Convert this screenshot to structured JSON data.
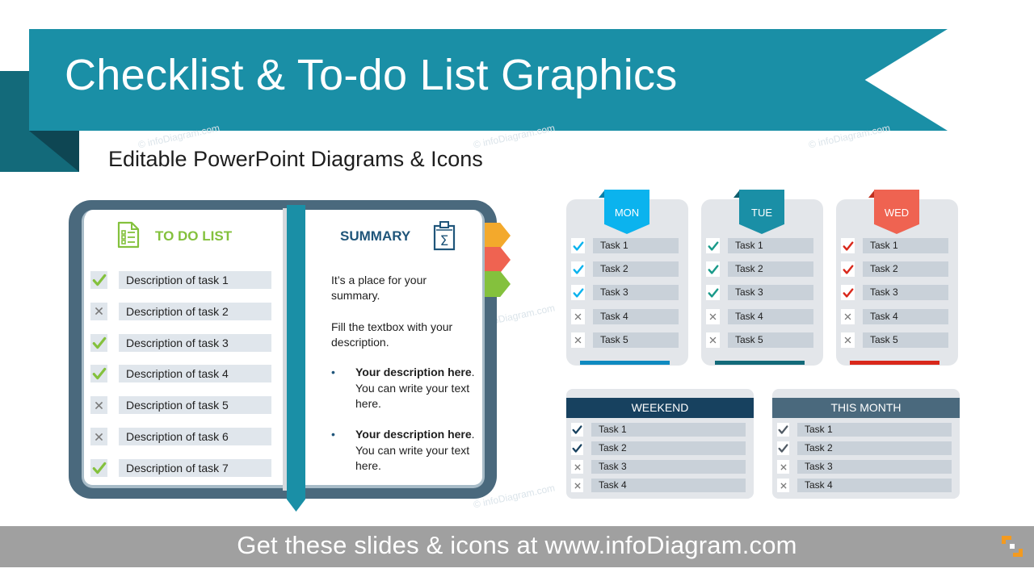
{
  "header": {
    "title": "Checklist & To-do List Graphics",
    "subtitle": "Editable PowerPoint Diagrams & Icons"
  },
  "watermark": "© infoDiagram.com",
  "colors": {
    "ribbon": "#1a8fa6",
    "todo_green": "#84c13d",
    "summary_blue": "#1f557a",
    "book_frame": "#4a697d",
    "mon": "#0bb3ee",
    "tue": "#1a8fa6",
    "wed": "#ef6351",
    "weekend": "#17415f",
    "this_month": "#4a697d",
    "footer": "#a0a0a0"
  },
  "book": {
    "todo": {
      "title": "TO DO LIST",
      "icon": "checklist-document-icon",
      "items": [
        {
          "label": "Description of task 1",
          "status": "done"
        },
        {
          "label": "Description of task 2",
          "status": "not-done"
        },
        {
          "label": "Description of task 3",
          "status": "done"
        },
        {
          "label": "Description of task 4",
          "status": "done"
        },
        {
          "label": "Description of task 5",
          "status": "not-done"
        },
        {
          "label": "Description of task 6",
          "status": "not-done"
        },
        {
          "label": "Description of task 7",
          "status": "done"
        }
      ]
    },
    "summary": {
      "title": "SUMMARY",
      "icon": "clipboard-sigma-icon",
      "para1": "It’s a place for your summary.",
      "para2": "Fill the textbox with your description.",
      "bullets": [
        {
          "bold": "Your description here",
          "rest": ". You can write your text here."
        },
        {
          "bold": "Your description here",
          "rest": ". You can write your text here."
        }
      ]
    },
    "tabs": [
      "#f3a92c",
      "#ef6351",
      "#84c13d"
    ]
  },
  "days": [
    {
      "label": "MON",
      "color": "#0bb3ee",
      "fold": "#0a7fa8",
      "bar": "#0f8ac0",
      "check_color": "#0bb3ee",
      "tasks": [
        {
          "label": "Task 1",
          "status": "done"
        },
        {
          "label": "Task 2",
          "status": "done"
        },
        {
          "label": "Task 3",
          "status": "done"
        },
        {
          "label": "Task 4",
          "status": "not-done"
        },
        {
          "label": "Task 5",
          "status": "not-done"
        }
      ]
    },
    {
      "label": "TUE",
      "color": "#1a8fa6",
      "fold": "#0e5e6e",
      "bar": "#136a7a",
      "check_color": "#1a9a8a",
      "tasks": [
        {
          "label": "Task 1",
          "status": "done"
        },
        {
          "label": "Task 2",
          "status": "done"
        },
        {
          "label": "Task 3",
          "status": "done"
        },
        {
          "label": "Task 4",
          "status": "not-done"
        },
        {
          "label": "Task 5",
          "status": "not-done"
        }
      ]
    },
    {
      "label": "WED",
      "color": "#ef6351",
      "fold": "#c0301f",
      "bar": "#d9281b",
      "check_color": "#d9281b",
      "tasks": [
        {
          "label": "Task 1",
          "status": "done"
        },
        {
          "label": "Task 2",
          "status": "done"
        },
        {
          "label": "Task 3",
          "status": "done"
        },
        {
          "label": "Task 4",
          "status": "not-done"
        },
        {
          "label": "Task 5",
          "status": "not-done"
        }
      ]
    }
  ],
  "lists": [
    {
      "label": "WEEKEND",
      "color": "#17415f",
      "check_color": "#17415f",
      "tasks": [
        {
          "label": "Task 1",
          "status": "done"
        },
        {
          "label": "Task 2",
          "status": "done"
        },
        {
          "label": "Task 3",
          "status": "not-done"
        },
        {
          "label": "Task 4",
          "status": "not-done"
        }
      ]
    },
    {
      "label": "THIS MONTH",
      "color": "#4a697d",
      "check_color": "#505a64",
      "tasks": [
        {
          "label": "Task 1",
          "status": "done"
        },
        {
          "label": "Task 2",
          "status": "done"
        },
        {
          "label": "Task 3",
          "status": "not-done"
        },
        {
          "label": "Task 4",
          "status": "not-done"
        }
      ]
    }
  ],
  "footer": {
    "text": "Get these slides & icons at www.infoDiagram.com",
    "logo": "infodiagram-logo-icon"
  }
}
